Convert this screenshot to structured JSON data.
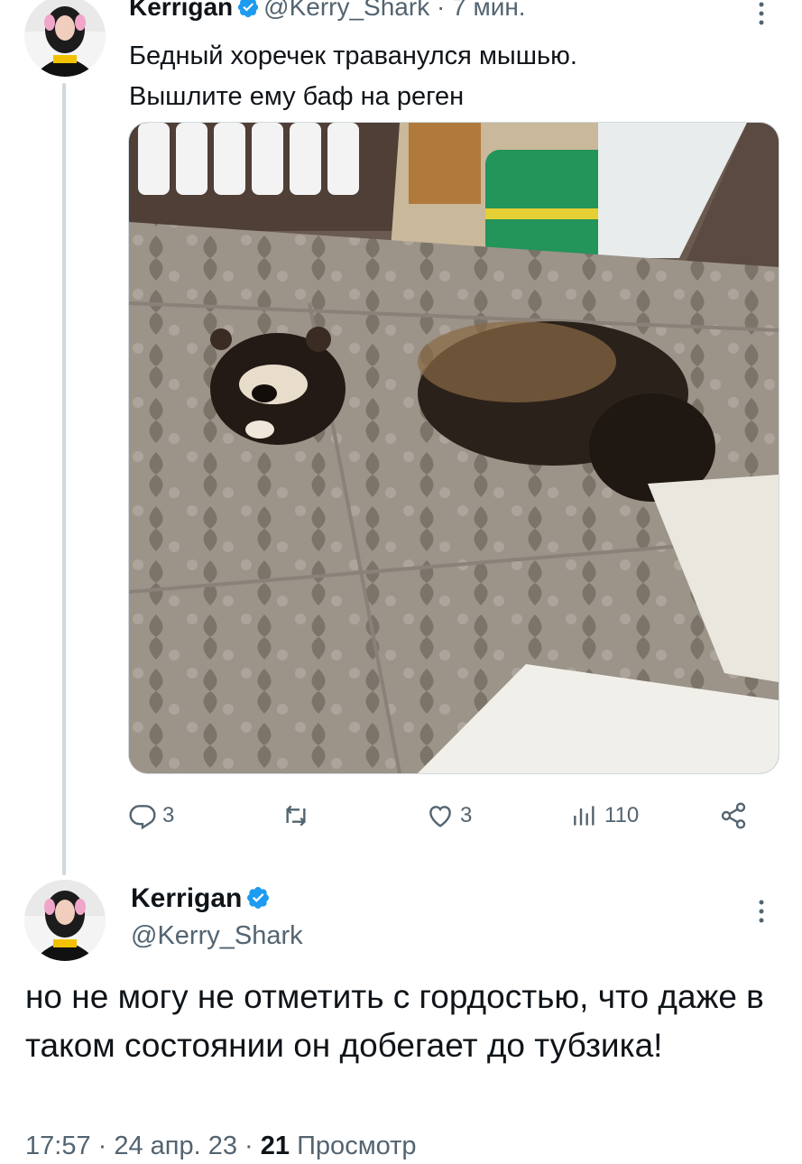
{
  "tweet1": {
    "author_name": "Kerrigan",
    "handle": "@Kerry_Shark",
    "separator": "·",
    "time_ago": "7 мин.",
    "text_line1": "Бедный хоречек траванулся мышью.",
    "text_line2": "Вышлите ему баф на реген",
    "actions": {
      "reply_count": "3",
      "retweet_count": "",
      "like_count": "3",
      "views_count": "110"
    },
    "icons": [
      "reply-icon",
      "retweet-icon",
      "like-icon",
      "views-icon",
      "share-icon"
    ]
  },
  "tweet2": {
    "author_name": "Kerrigan",
    "handle": "@Kerry_Shark",
    "text": "но не могу не отметить с гордостью, что даже в таком состоянии он добегает до тубзика!",
    "timestamp": "17:57 · 24 апр. 23 · ",
    "views_number": "21",
    "views_label": " Просмотр"
  },
  "colors": {
    "verified_blue": "#1d9bf0",
    "text": "#0f1419",
    "muted": "#536471",
    "thread_line": "#cfd9de"
  }
}
